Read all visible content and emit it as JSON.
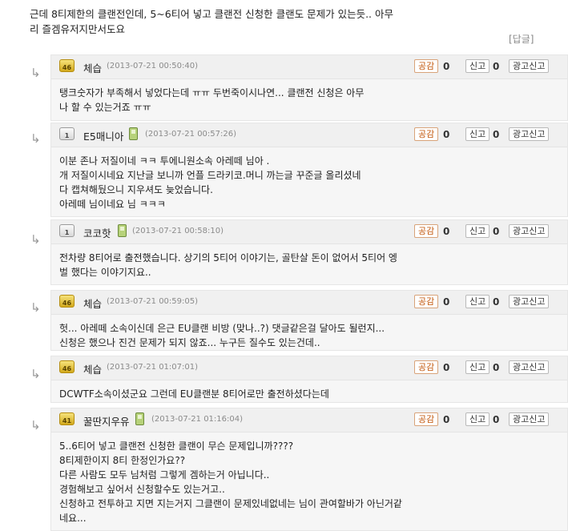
{
  "post": {
    "line1": "근데 8티제한의 클랜전인데, 5~6티어 넣고 클랜전 신청한 클랜도 문제가 있는듯.. 아무",
    "line2": "리 즐겜유저지만서도요",
    "reply_label": "[답글]"
  },
  "buttons": {
    "agree": "공감",
    "report": "신고",
    "ad_report": "광고신고"
  },
  "icons": {
    "reply_arrow": "↳"
  },
  "comments": [
    {
      "level": "46",
      "nick": "체습",
      "date": "(2013-07-21 00:50:40)",
      "agree": "0",
      "report": "0",
      "lines": [
        "탱크숫자가 부족해서 넣었다는데 ㅠㅠ 두번죽이시나연... 클랜전 신청은 아무",
        "나 할 수 있는거죠 ㅠㅠ"
      ]
    },
    {
      "level": "1",
      "nick": "E5매니아",
      "date": "(2013-07-21 00:57:26)",
      "agree": "0",
      "report": "0",
      "lines": [
        "이분 존나 저질이네 ㅋㅋ 투에니원소속 아레떼 님아 .",
        "개 저질이시네요 지난글 보니까 언플  드라키코.머니 까는글 꾸준글 올리셨네",
        "다 캡쳐해뒀으니 지우셔도 늦었습니다.",
        "아레떼 님이네요 님 ㅋㅋㅋ"
      ]
    },
    {
      "level": "1",
      "nick": "코코핫",
      "date": "(2013-07-21 00:58:10)",
      "agree": "0",
      "report": "0",
      "lines": [
        "전차량 8티어로 출전했습니다. 상기의 5티어 이야기는, 골탄살 돈이 없어서 5티어 엥",
        "벌 했다는 이야기지요.."
      ]
    },
    {
      "level": "46",
      "nick": "체습",
      "date": "(2013-07-21 00:59:05)",
      "agree": "0",
      "report": "0",
      "lines": [
        "헛... 아레떼 소속이신데 은근 EU클랜 비방 (맞나..?) 댓글같은걸 달아도 될런지...",
        "신청은 했으나 진건 문제가 되지 않죠... 누구든 질수도 있는건데.."
      ]
    },
    {
      "level": "46",
      "nick": "체습",
      "date": "(2013-07-21 01:07:01)",
      "agree": "0",
      "report": "0",
      "lines": [
        "DCWTF소속이셨군요 그런데 EU클랜분 8티어로만 출전하셨다는데"
      ]
    },
    {
      "level": "41",
      "nick": "꿀딴지우유",
      "date": "(2013-07-21 01:16:04)",
      "agree": "0",
      "report": "0",
      "lines": [
        "5..6티어 넣고 클랜전 신청한 클랜이 무슨 문제입니까????",
        "8티제한이지 8티 한정인가요??",
        "다른 사람도 모두 님처럼 그렇게 겜하는거 아닙니다..",
        "경험해보고 싶어서 신청할수도 있는거고..",
        "신청하고 전투하고 지면 지는거지 그클랜이 문제있네없네는 님이 관여할바가 아닌거같",
        "네요..."
      ]
    }
  ]
}
